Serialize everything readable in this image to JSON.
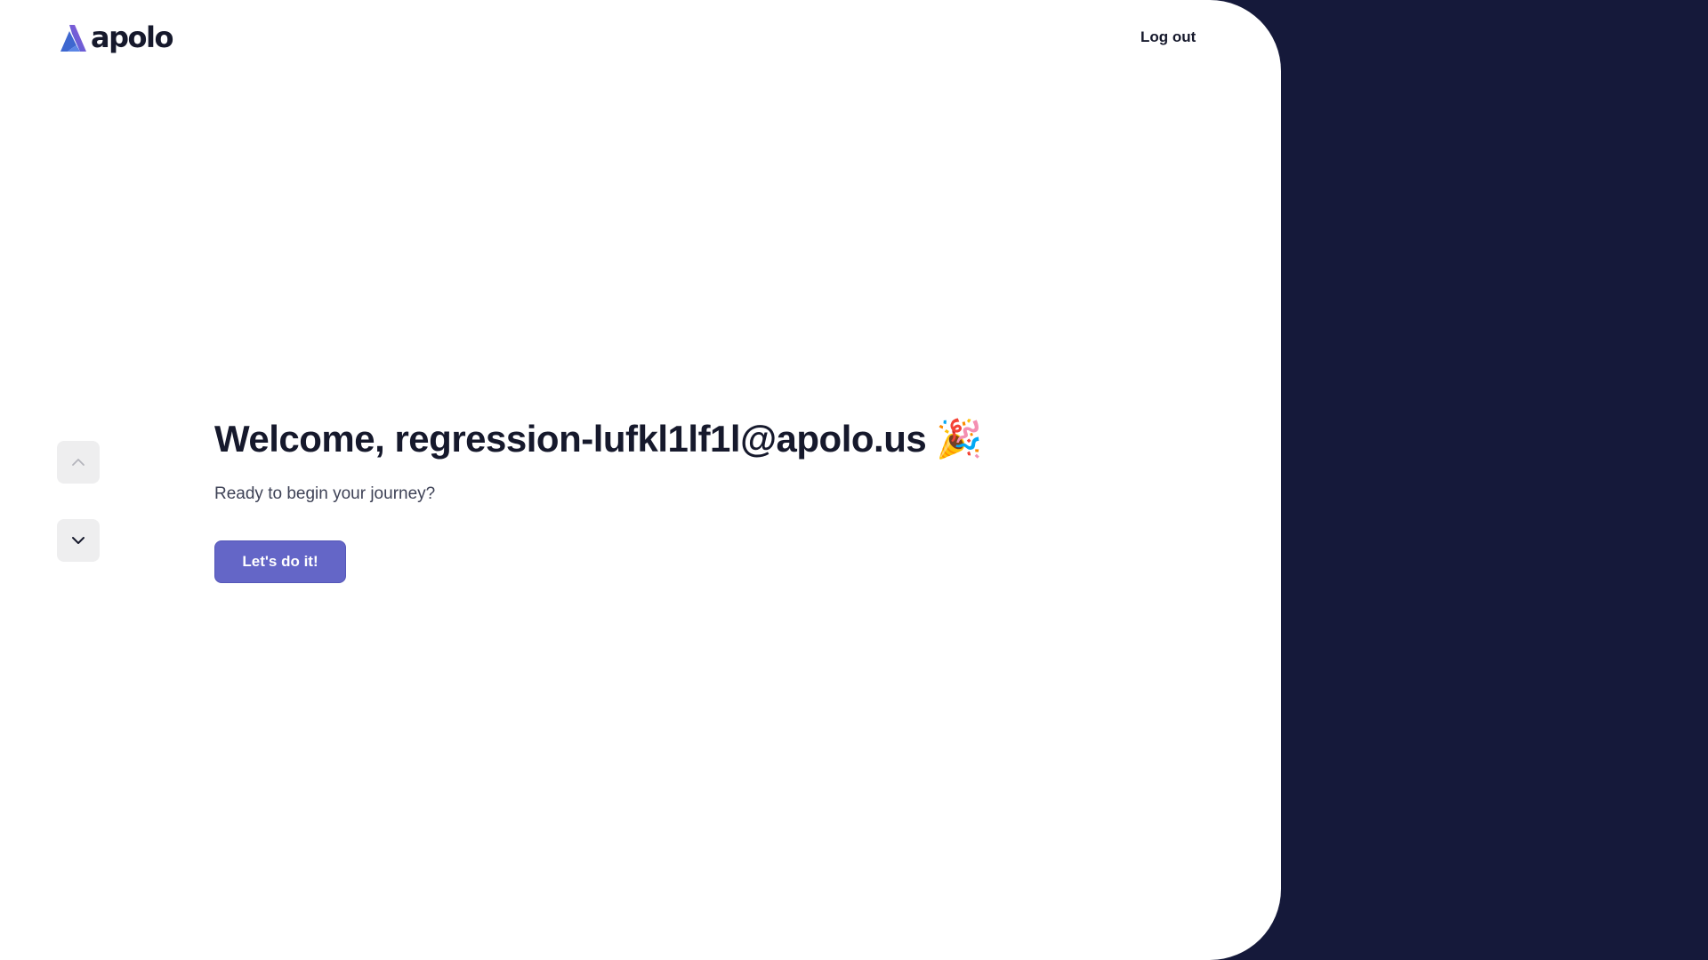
{
  "header": {
    "logo_text": "apolo",
    "logo_icon": "apolo-logo-icon",
    "logout_label": "Log out"
  },
  "nav": {
    "up_icon": "chevron-up-icon",
    "down_icon": "chevron-down-icon"
  },
  "main": {
    "title": "Welcome, regression-lufkl1lf1l@apolo.us 🎉",
    "subtitle": "Ready to begin your journey?",
    "cta_label": "Let's do it!"
  },
  "colors": {
    "panel_background": "#ffffff",
    "side_background": "#15193a",
    "accent": "#6466c7",
    "text_dark": "#16192c",
    "nav_button_bg": "#eeeeef"
  }
}
